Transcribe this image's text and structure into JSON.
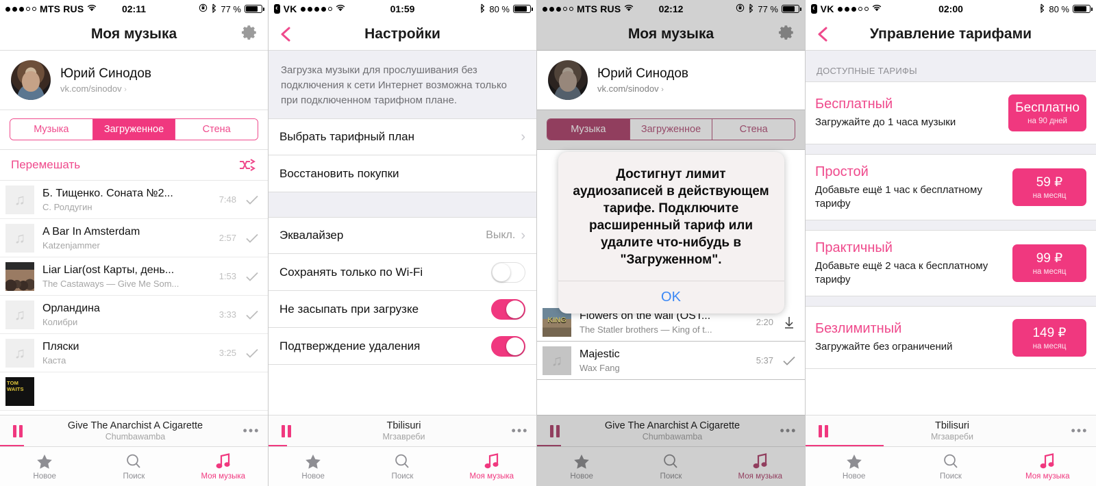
{
  "screens": [
    {
      "status": {
        "carrier": "MTS RUS",
        "time": "02:11",
        "battery": "77 %",
        "dots_filled": 3,
        "dots_total": 5
      },
      "nav": {
        "title": "Моя музыка",
        "right_icon": "gear-icon"
      },
      "profile": {
        "name": "Юрий Синодов",
        "link": "vk.com/sinodov",
        "chev": "›"
      },
      "segments": [
        {
          "label": "Музыка",
          "active": false
        },
        {
          "label": "Загруженное",
          "active": true
        },
        {
          "label": "Стена",
          "active": false
        }
      ],
      "shuffle": {
        "label": "Перемешать",
        "icon": "shuffle-icon"
      },
      "tracks": [
        {
          "title": "Б. Тищенко. Соната №2...",
          "artist": "С. Ролдугин",
          "duration": "7:48",
          "state": "check-icon",
          "art": "note"
        },
        {
          "title": "A Bar In Amsterdam",
          "artist": "Katzenjammer",
          "duration": "2:57",
          "state": "check-icon",
          "art": "note"
        },
        {
          "title": "Liar Liar(ost Карты, день...",
          "artist": "The Castaways — Give Me Som...",
          "duration": "1:53",
          "state": "check-icon",
          "art": "cover-castaways"
        },
        {
          "title": "Орландина",
          "artist": "Колибри",
          "duration": "3:33",
          "state": "check-icon",
          "art": "note"
        },
        {
          "title": "Пляски",
          "artist": "Каста",
          "duration": "3:25",
          "state": "check-icon",
          "art": "note"
        },
        {
          "title": "",
          "artist": "",
          "duration": "",
          "state": "",
          "art": "cover-tomwaits"
        }
      ],
      "player": {
        "title": "Give The Anarchist A Cigarette",
        "artist": "Chumbawamba",
        "button": "pause-icon",
        "more": "•••",
        "progress_pct": 9
      },
      "tabs": [
        {
          "label": "Новое",
          "icon": "star-icon",
          "active": false
        },
        {
          "label": "Поиск",
          "icon": "search-icon",
          "active": false
        },
        {
          "label": "Моя музыка",
          "icon": "music-note-icon",
          "active": true
        }
      ]
    },
    {
      "status": {
        "carrier": "VK",
        "back_chip": "‹",
        "time": "01:59",
        "battery": "80 %",
        "dots_filled": 4,
        "dots_total": 5
      },
      "nav": {
        "title": "Настройки",
        "left_icon": "chevron-back-icon"
      },
      "note": "Загрузка музыки для прослушивания без подключения к сети Интернет возможна только при подключенном тарифном плане.",
      "cells": [
        {
          "label": "Выбрать тарифный план",
          "accessory": "chevron",
          "value": ""
        },
        {
          "label": "Восстановить покупки",
          "accessory": "none",
          "value": ""
        }
      ],
      "cells2": [
        {
          "label": "Эквалайзер",
          "accessory": "chevron",
          "value": "Выкл."
        },
        {
          "label": "Сохранять только по Wi-Fi",
          "accessory": "switch",
          "on": false
        },
        {
          "label": "Не засыпать при загрузке",
          "accessory": "switch",
          "on": true
        },
        {
          "label": "Подтверждение удаления",
          "accessory": "switch",
          "on": true
        }
      ],
      "player": {
        "title": "Tbilisuri",
        "artist": "Мгзавреби",
        "button": "pause-icon",
        "more": "•••",
        "progress_pct": 7
      },
      "tabs": [
        {
          "label": "Новое",
          "icon": "star-icon",
          "active": false
        },
        {
          "label": "Поиск",
          "icon": "search-icon",
          "active": false
        },
        {
          "label": "Моя музыка",
          "icon": "music-note-icon",
          "active": true
        }
      ]
    },
    {
      "status": {
        "carrier": "MTS RUS",
        "time": "02:12",
        "battery": "77 %",
        "dots_filled": 3,
        "dots_total": 5
      },
      "nav": {
        "title": "Моя музыка",
        "right_icon": "gear-icon"
      },
      "profile": {
        "name": "Юрий Синодов",
        "link": "vk.com/sinodov",
        "chev": "›"
      },
      "segments": [
        {
          "label": "Музыка",
          "active": true
        },
        {
          "label": "Загруженное",
          "active": false
        },
        {
          "label": "Стена",
          "active": false
        }
      ],
      "tracks": [
        {
          "title": "Flowers on the wall (OST...",
          "artist": "The Statler brothers — King of t...",
          "duration": "2:20",
          "state": "download-icon",
          "art": "cover-king"
        },
        {
          "title": "Majestic",
          "artist": "Wax Fang",
          "duration": "5:37",
          "state": "check-icon",
          "art": "note"
        }
      ],
      "alert": {
        "message": "Достигнут лимит аудиозаписей в действующем тарифе. Подключите расширенный тариф или удалите что-нибудь в \"Загруженном\".",
        "button": "OK"
      },
      "player": {
        "title": "Give The Anarchist A Cigarette",
        "artist": "Chumbawamba",
        "button": "pause-icon",
        "more": "•••",
        "progress_pct": 9
      },
      "tabs": [
        {
          "label": "Новое",
          "icon": "star-icon",
          "active": false
        },
        {
          "label": "Поиск",
          "icon": "search-icon",
          "active": false
        },
        {
          "label": "Моя музыка",
          "icon": "music-note-icon",
          "active": true
        }
      ]
    },
    {
      "status": {
        "carrier": "VK",
        "back_chip": "‹",
        "time": "02:00",
        "battery": "80 %",
        "dots_filled": 3,
        "dots_total": 5
      },
      "nav": {
        "title": "Управление тарифами",
        "left_icon": "chevron-back-icon"
      },
      "section_header": "ДОСТУПНЫЕ ТАРИФЫ",
      "tariffs": [
        {
          "name": "Бесплатный",
          "desc": "Загружайте до 1 часа музыки",
          "price": "Бесплатно",
          "period": "на 90 дней"
        },
        {
          "name": "Простой",
          "desc": "Добавьте ещё 1 час к бесплатному тарифу",
          "price": "59 ₽",
          "period": "на месяц"
        },
        {
          "name": "Практичный",
          "desc": "Добавьте ещё 2 часа к бесплатному тарифу",
          "price": "99 ₽",
          "period": "на месяц"
        },
        {
          "name": "Безлимитный",
          "desc": "Загружайте без ограничений",
          "price": "149 ₽",
          "period": "на месяц"
        }
      ],
      "player": {
        "title": "Tbilisuri",
        "artist": "Мгзавреби",
        "button": "pause-icon",
        "more": "•••",
        "progress_pct": 27
      },
      "tabs": [
        {
          "label": "Новое",
          "icon": "star-icon",
          "active": false
        },
        {
          "label": "Поиск",
          "icon": "search-icon",
          "active": false
        },
        {
          "label": "Моя музыка",
          "icon": "music-note-icon",
          "active": true
        }
      ]
    }
  ],
  "colors": {
    "accent": "#f0387f",
    "accent_light": "#ef4a8c",
    "alert_button": "#3b88f5",
    "grouped_bg": "#efeff4"
  }
}
